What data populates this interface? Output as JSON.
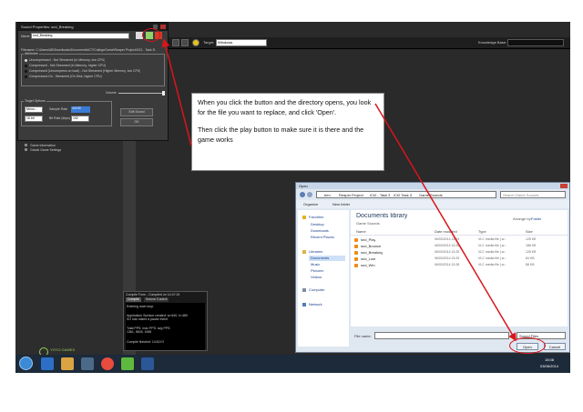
{
  "sound_properties": {
    "title": "Sound Properties: snd_Breaking",
    "name_label": "Name:",
    "name_value": "snd_Breaking",
    "filename_label": "Filename:",
    "filename_value": "C:\\Users\\AB\\Downloads\\Documents\\ICT\\CollegeGame\\Reaper Project\\ICt2 - Task 3\\",
    "attributes_label": "Attributes",
    "attributes": [
      "Uncompressed - Not Streamed (In Memory, low CPU)",
      "Compressed - Not Streamed (In Memory, higher CPU)",
      "Compressed (Uncompress on load) - Not Streamed (Higher Memory, low CPU)",
      "Compressed-On - Streamed (On Disk, higher CPU)"
    ],
    "volume_label": "Volume",
    "target_options_label": "Target Options",
    "mono_value": "Mono...",
    "sample_rate_label": "Sample Rate",
    "sample_rate_value": "44100",
    "bits_value": "16 bit",
    "bit_rate_label": "Bit Rate (kbps)",
    "bit_rate_value": "192",
    "edit_sound_label": "Edit Sound",
    "ok_label": "OK"
  },
  "toolbar": {
    "target_label": "Target:",
    "target_value": "Windows",
    "knowledge_base_label": "Knowledge Base:"
  },
  "resource_tree": {
    "items": [
      "Game Information",
      "Global Game Settings"
    ]
  },
  "compile": {
    "title": "Compile Form - Compiled on 14:47:24",
    "tabs": [
      "Compile",
      "Source Control"
    ],
    "lines": [
      "Entering main loop.",
      "",
      "Application Surface created: w=640, h=480",
      "SO has raised a pause event",
      "",
      "Total PPS: max PPS: avg PPS:",
      "1361, 9605, 1965",
      "",
      "Compile finished: 14:52:07"
    ]
  },
  "yoyo_logo": "YOYO GAMES",
  "annotation": {
    "paragraph1": "When you click the button and the directory opens, you look for the file you want to replace, and click 'Open'.",
    "paragraph2": "Then click the play button to make sure it is there and the game works"
  },
  "open_dialog": {
    "title": "Open",
    "breadcrumb": [
      "ben",
      "Reaper Project",
      "ICt2 - Task 3",
      "ICt2 Task 3",
      "Game Sounds"
    ],
    "search_placeholder": "Search Game Sounds",
    "organize_label": "Organize",
    "new_folder_label": "New folder",
    "sidebar": {
      "favorites_label": "Favorites",
      "favorites": [
        "Desktop",
        "Downloads",
        "Recent Places"
      ],
      "libraries_label": "Libraries",
      "libraries": [
        "Documents",
        "Music",
        "Pictures",
        "Videos"
      ],
      "computer_label": "Computer",
      "network_label": "Network"
    },
    "library_title": "Documents library",
    "library_subtitle": "Game Sounds",
    "arrange_by_label": "Arrange by:",
    "arrange_by_value": "Folder",
    "columns": [
      "Name",
      "Date modified",
      "Type",
      "Size"
    ],
    "files": [
      {
        "name": "snd_Play",
        "date": "06/03/2014 13:24",
        "type": "VLC media file (.w...",
        "size": "125 KB"
      },
      {
        "name": "snd_Bounce",
        "date": "06/03/2014 13:26",
        "type": "VLC media file (.w...",
        "size": "186 KB"
      },
      {
        "name": "snd_Breaking",
        "date": "06/03/2014 13:25",
        "type": "VLC media file (.w...",
        "size": "126 KB"
      },
      {
        "name": "snd_Lost",
        "date": "06/03/2014 13:29",
        "type": "VLC media file (.w...",
        "size": "84 KB"
      },
      {
        "name": "snd_Win",
        "date": "06/03/2014 13:28",
        "type": "VLC media file (.w...",
        "size": "88 KB"
      }
    ],
    "filename_label": "File name:",
    "filetype_value": "Sound Files",
    "open_label": "Open",
    "cancel_label": "Cancel"
  },
  "taskbar": {
    "time": "15:08",
    "date": "03/06/2014"
  },
  "colors": {
    "highlight_red": "#d9151b",
    "dialog_bg": "#dfe7f1",
    "app_dark": "#2a2a2a"
  }
}
